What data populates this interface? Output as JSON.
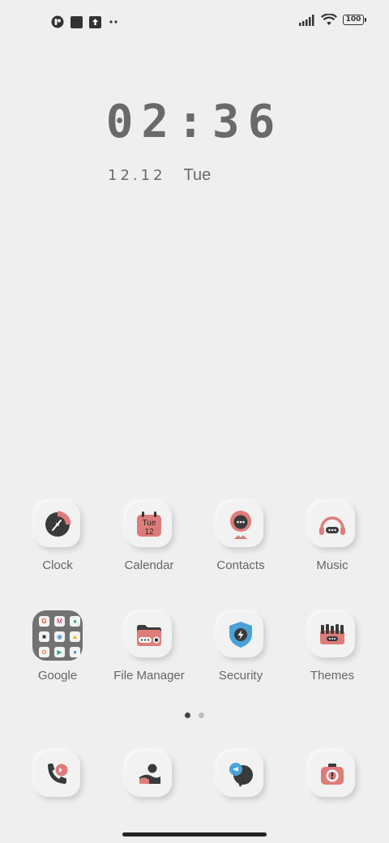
{
  "status_bar": {
    "left_icons": [
      "app-badge-icon",
      "square-notification-icon",
      "upload-icon",
      "more-notifications-icon"
    ],
    "battery": "100"
  },
  "lock_clock": {
    "time": "02:36",
    "date": "12.12",
    "weekday": "Tue"
  },
  "apps": [
    {
      "label": "Clock"
    },
    {
      "label": "Calendar",
      "icon_day": "Tue",
      "icon_date": "12"
    },
    {
      "label": "Contacts"
    },
    {
      "label": "Music"
    },
    {
      "label": "Google"
    },
    {
      "label": "File Manager"
    },
    {
      "label": "Security"
    },
    {
      "label": "Themes"
    }
  ],
  "dock": [
    "phone-icon",
    "gallery-icon",
    "messages-icon",
    "camera-icon"
  ],
  "page_indicator": {
    "pages": 2,
    "current": 1
  },
  "colors": {
    "accent": "#de7c7a",
    "dark": "#3a3a3a",
    "blue": "#4aa3d8",
    "background": "#efefef"
  }
}
